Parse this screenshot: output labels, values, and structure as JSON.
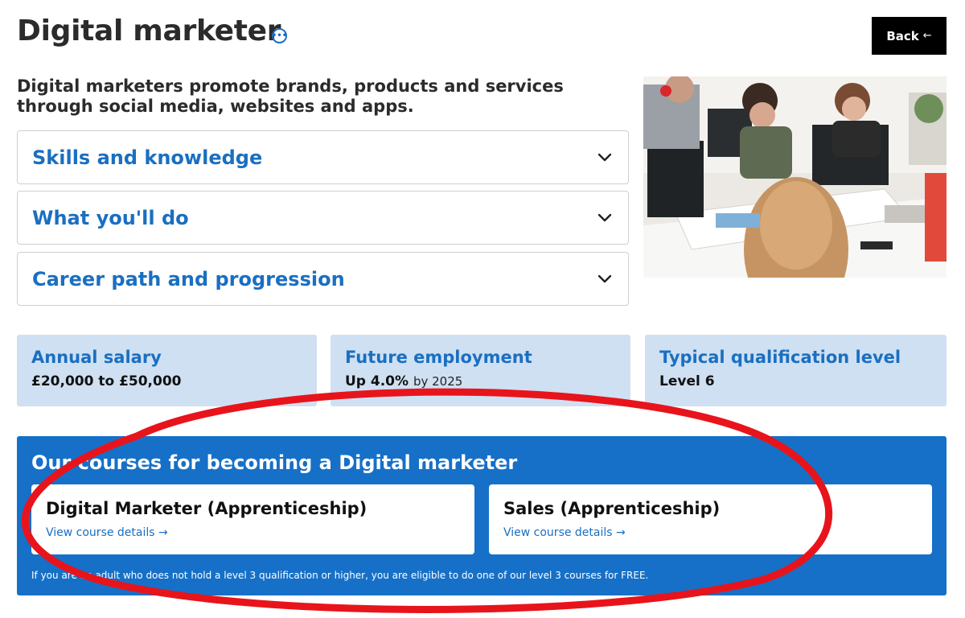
{
  "header": {
    "title": "Digital marketer",
    "back_label": "Back"
  },
  "intro": "Digital marketers promote brands, products and services through social media, websites and apps.",
  "accordions": [
    {
      "label": "Skills and knowledge"
    },
    {
      "label": "What you'll do"
    },
    {
      "label": "Career path and progression"
    }
  ],
  "stats": [
    {
      "label": "Annual salary",
      "value": "£20,000 to £50,000",
      "suffix": ""
    },
    {
      "label": "Future employment",
      "value": "Up 4.0%",
      "suffix": "by 2025"
    },
    {
      "label": "Typical qualification level",
      "value": "Level 6",
      "suffix": ""
    }
  ],
  "courses": {
    "heading": "Our courses for becoming a Digital marketer",
    "items": [
      {
        "title": "Digital Marketer (Apprenticeship)",
        "link": "View course details"
      },
      {
        "title": "Sales (Apprenticeship)",
        "link": "View course details"
      }
    ],
    "note": "If you are an adult who does not hold a level 3 qualification or higher, you are eligible to do one of our level 3 courses for FREE."
  },
  "colors": {
    "accent": "#1a6fc1",
    "stat_bg": "#cfe0f2",
    "courses_bg": "#1670c7",
    "annotation": "#e8141b"
  },
  "icons": {
    "title": "info-circle-icon",
    "back": "arrow-left-icon",
    "accordion": "chevron-down-icon",
    "link": "arrow-right-icon"
  }
}
